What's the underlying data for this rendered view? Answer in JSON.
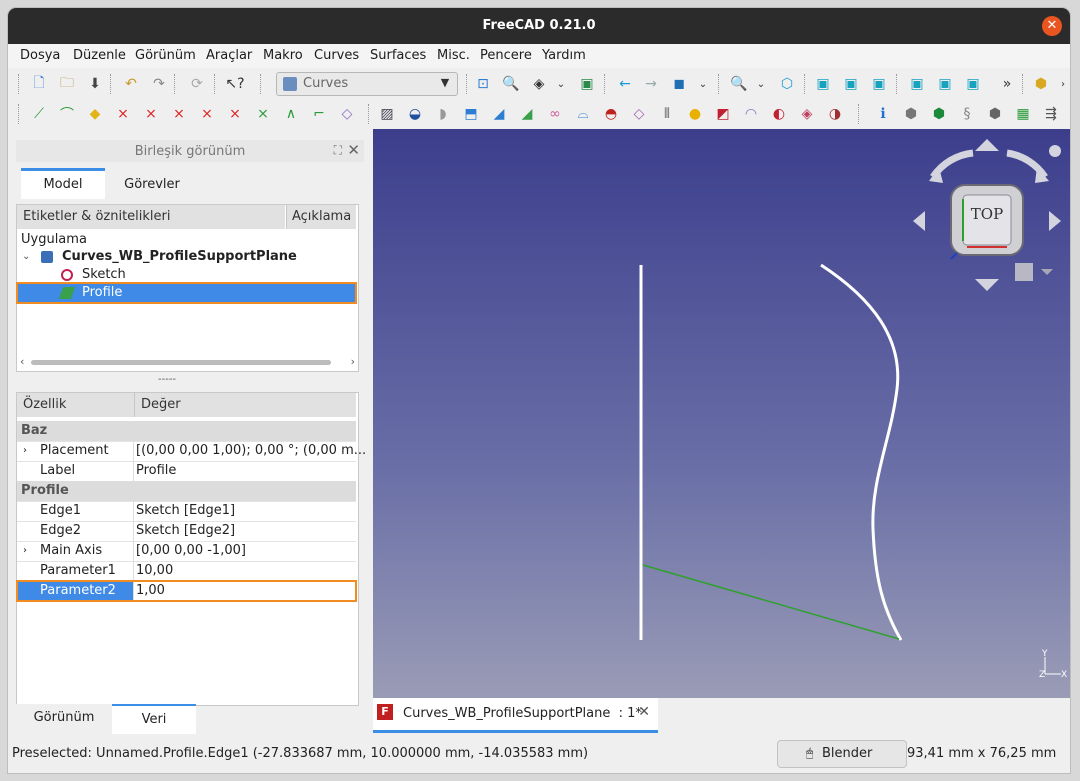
{
  "window": {
    "title": "FreeCAD 0.21.0"
  },
  "menu": [
    "Dosya",
    "Düzenle",
    "Görünüm",
    "Araçlar",
    "Makro",
    "Curves",
    "Surfaces",
    "Misc.",
    "Pencere",
    "Yardım"
  ],
  "workbench": {
    "selected": "Curves"
  },
  "combo": {
    "title": "Birleşik görünüm",
    "tabs": [
      "Model",
      "Görevler"
    ],
    "tree_headers": [
      "Etiketler & öznitelikleri",
      "Açıklama"
    ],
    "tree": {
      "root": "Uygulama",
      "document": "Curves_WB_ProfileSupportPlane",
      "items": [
        "Sketch",
        "Profile"
      ]
    },
    "splitter": "-----",
    "props_headers": [
      "Özellik",
      "Değer"
    ],
    "props": [
      {
        "group": "Baz"
      },
      {
        "key": "Placement",
        "value": "[(0,00 0,00 1,00); 0,00 °; (0,00 m..."
      },
      {
        "key": "Label",
        "value": "Profile"
      },
      {
        "group": "Profile"
      },
      {
        "key": "Edge1",
        "value": "Sketch [Edge1]"
      },
      {
        "key": "Edge2",
        "value": "Sketch [Edge2]"
      },
      {
        "key": "Main Axis",
        "value": "[0,00 0,00 -1,00]"
      },
      {
        "key": "Parameter1",
        "value": "10,00"
      },
      {
        "key": "Parameter2",
        "value": "1,00"
      }
    ],
    "bottom_tabs": [
      "Görünüm",
      "Veri"
    ]
  },
  "navcube": {
    "face": "TOP"
  },
  "axes": {
    "y": "Y",
    "z": "Z",
    "x": "X"
  },
  "doc_tab": {
    "label": "Curves_WB_ProfileSupportPlane  : 1*"
  },
  "status": {
    "message": "Preselected: Unnamed.Profile.Edge1 (-27.833687 mm, 10.000000 mm, -14.035583 mm)",
    "nav_style": "Blender",
    "dimensions": "93,41 mm x 76,25 mm"
  },
  "colors": {
    "accent": "#3a8ee6",
    "highlight": "#f08c22",
    "title_bg": "#2b2b2b",
    "close": "#e95420"
  }
}
